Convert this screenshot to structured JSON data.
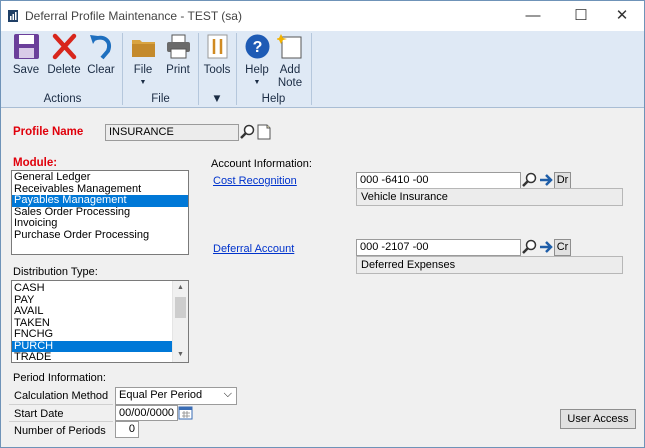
{
  "window": {
    "title": "Deferral Profile Maintenance  -  TEST (sa)",
    "minimize_glyph": "—",
    "maximize_glyph": "☐",
    "close_glyph": "✕"
  },
  "ribbon": {
    "save": "Save",
    "delete": "Delete",
    "clear": "Clear",
    "file": "File",
    "print": "Print",
    "tools": "Tools",
    "help": "Help",
    "add_note_line1": "Add",
    "add_note_line2": "Note",
    "groups": {
      "actions": "Actions",
      "file": "File",
      "help": "Help"
    },
    "arrow": "▼"
  },
  "profile": {
    "label": "Profile Name",
    "value": "INSURANCE"
  },
  "module": {
    "label": "Module:",
    "items": [
      "General Ledger",
      "Receivables Management",
      "Payables Management",
      "Sales Order Processing",
      "Invoicing",
      "Purchase Order Processing"
    ],
    "selected_index": 2
  },
  "distribution": {
    "label": "Distribution Type:",
    "items": [
      "CASH",
      "PAY",
      "AVAIL",
      "TAKEN",
      "FNCHG",
      "PURCH",
      "TRADE"
    ],
    "selected_index": 5,
    "scroll_up": "▲",
    "scroll_down": "▼"
  },
  "account_info": {
    "label": "Account Information:",
    "cost_recognition": {
      "link": "Cost Recognition",
      "account": "000 -6410 -00",
      "description": "Vehicle Insurance",
      "side": "Dr"
    },
    "deferral_account": {
      "link": "Deferral Account",
      "account": "000 -2107 -00",
      "description": "Deferred Expenses",
      "side": "Cr"
    }
  },
  "period": {
    "label": "Period Information:",
    "calc_method_label": "Calculation Method",
    "calc_method_value": "Equal Per Period",
    "start_date_label": "Start Date",
    "start_date_value": "00/00/0000",
    "num_periods_label": "Number of Periods",
    "num_periods_value": "0",
    "dropdown_glyph": "⌵"
  },
  "user_access_button": "User Access",
  "colors": {
    "accent": "#0078d7",
    "required_label": "#e0000b",
    "link": "#0033cc",
    "ribbon_bg": "#dfe9f5"
  }
}
